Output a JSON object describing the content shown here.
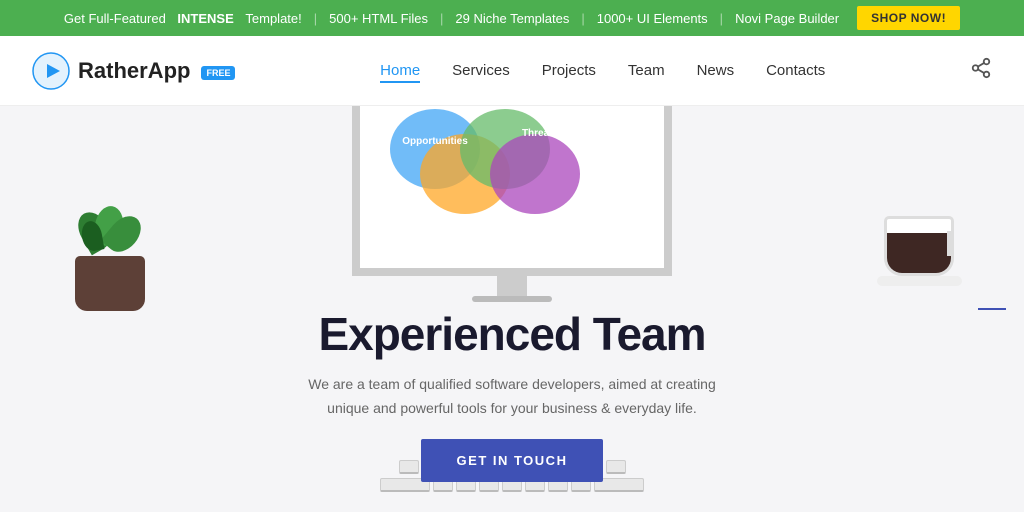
{
  "banner": {
    "prefix": "Get Full-Featured",
    "brand": "INTENSE",
    "suffix": "Template!",
    "stat1": "500+ HTML Files",
    "sep1": "|",
    "stat2": "29 Niche Templates",
    "sep2": "|",
    "stat3": "1000+ UI Elements",
    "sep3": "|",
    "stat4": "Novi Page Builder",
    "shop_label": "SHOP NOW!",
    "bg_color": "#4caf50",
    "btn_color": "#ffd600"
  },
  "navbar": {
    "logo_name": "RatherApp",
    "free_badge": "Free",
    "nav_items": [
      {
        "label": "Home",
        "active": true
      },
      {
        "label": "Services",
        "active": false
      },
      {
        "label": "Projects",
        "active": false
      },
      {
        "label": "Team",
        "active": false
      },
      {
        "label": "News",
        "active": false
      },
      {
        "label": "Contacts",
        "active": false
      }
    ]
  },
  "hero": {
    "title": "Experienced Team",
    "subtitle": "We are a team of qualified software developers, aimed at creating unique and powerful tools for your business & everyday life.",
    "cta_label": "GET IN TOUCH",
    "venn_label1": "Opportunities",
    "venn_label2": "Threats"
  }
}
